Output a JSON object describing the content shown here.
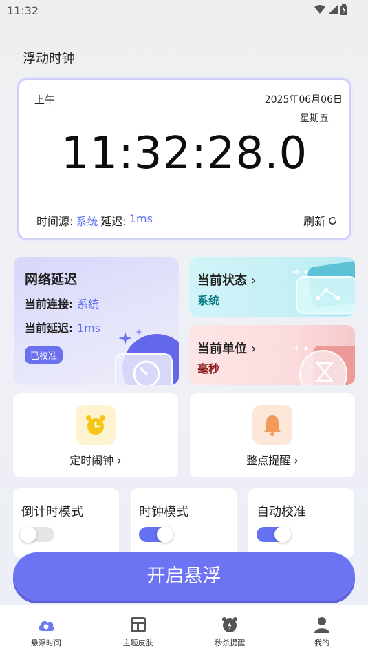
{
  "status_bar": {
    "time": "11:32"
  },
  "page_title": "浮动时钟",
  "clock": {
    "ampm": "上午",
    "date": "2025年06月06日",
    "weekday": "星期五",
    "time": "11:32:28.0",
    "source_label": "时间源:",
    "source_value": "系统",
    "delay_label": "延迟:",
    "delay_value": "1ms",
    "refresh_label": "刷新"
  },
  "network": {
    "title": "网络延迟",
    "connection_label": "当前连接:",
    "connection_value": "系统",
    "delay_label": "当前延迟:",
    "delay_value": "1ms",
    "badge": "已校准"
  },
  "state_card": {
    "title": "当前状态",
    "value": "系统"
  },
  "unit_card": {
    "title": "当前单位",
    "value": "毫秒"
  },
  "tiles": {
    "alarm": "定时闹钟",
    "hourly": "整点提醒"
  },
  "modes": [
    {
      "label": "倒计时模式",
      "on": false
    },
    {
      "label": "时钟模式",
      "on": true
    },
    {
      "label": "自动校准",
      "on": true
    }
  ],
  "start_button": "开启悬浮",
  "tabs": [
    "悬浮时间",
    "主题皮肤",
    "秒杀提醒",
    "我的"
  ],
  "colors": {
    "accent": "#6d74f3",
    "blue_text": "#5b6ef2",
    "teal_text": "#0f7f8a",
    "red_text": "#8a1d1d"
  }
}
